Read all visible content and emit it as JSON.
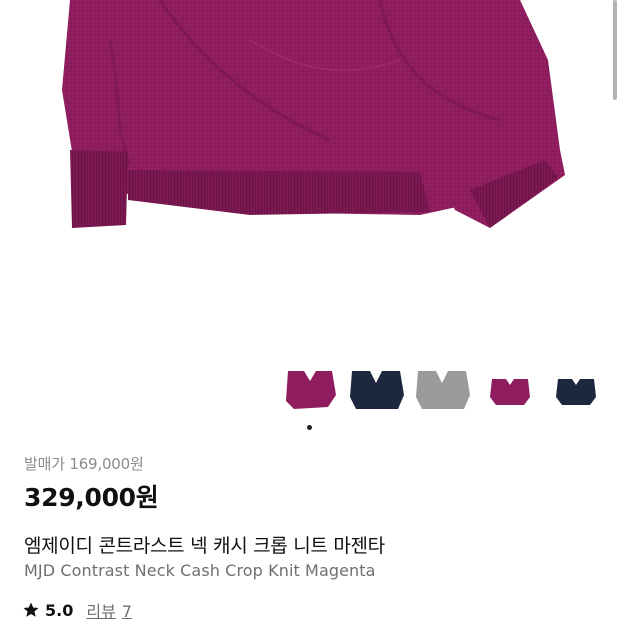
{
  "gallery": {
    "thumbnails": [
      {
        "name": "magenta-front",
        "color": "#8e1c5e"
      },
      {
        "name": "navy-front",
        "color": "#1e2740"
      },
      {
        "name": "gray-front",
        "color": "#9b9b9b"
      },
      {
        "name": "magenta-small",
        "color": "#8e1c5e"
      },
      {
        "name": "navy-small",
        "color": "#1e2740"
      }
    ],
    "active_index": 0
  },
  "product": {
    "original_price": "발매가 169,000원",
    "price": "329,000원",
    "name_ko": "엠제이디 콘트라스트 넥 캐시 크롭 니트 마젠타",
    "name_en": "MJD Contrast Neck Cash Crop Knit Magenta"
  },
  "rating": {
    "score": "5.0",
    "review_label": "리뷰",
    "review_count": "7",
    "icon": "star-icon"
  },
  "colors": {
    "knit": "#8e1c5e",
    "knit_dark": "#6f1548",
    "navy": "#1e2740",
    "gray": "#9b9b9b"
  }
}
